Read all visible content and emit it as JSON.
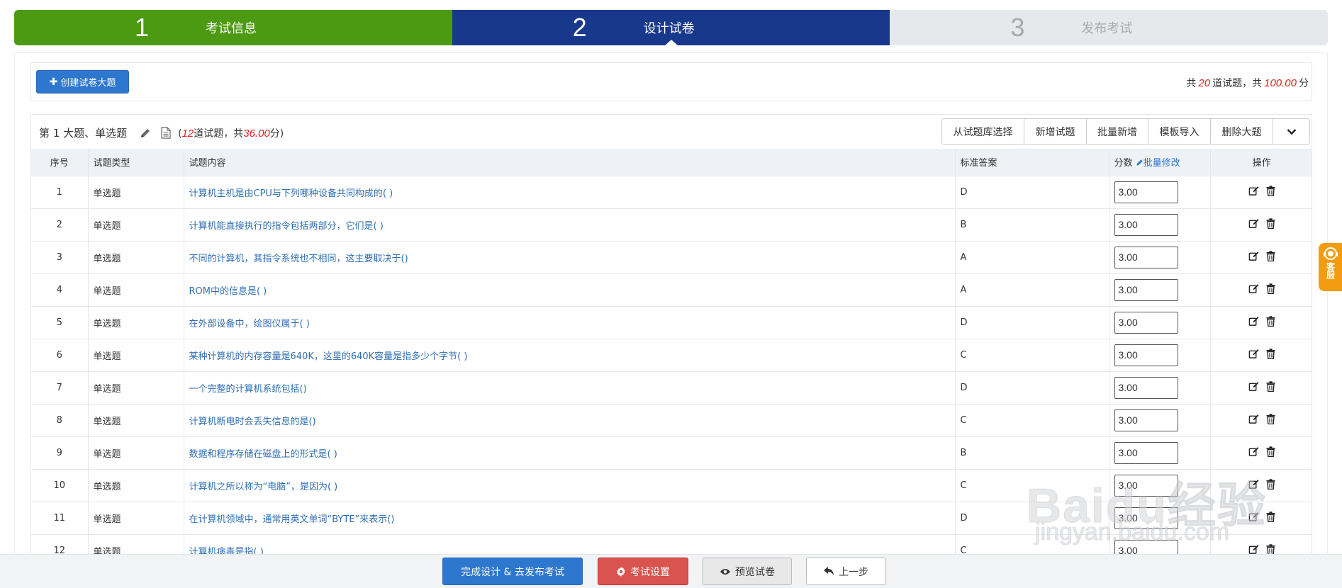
{
  "steps": [
    {
      "num": "1",
      "label": "考试信息"
    },
    {
      "num": "2",
      "label": "设计试卷"
    },
    {
      "num": "3",
      "label": "发布考试"
    }
  ],
  "toolbar": {
    "create_label": "创建试卷大题",
    "total_prefix": "共",
    "total_count": "20",
    "total_mid": "道试题，共",
    "total_score": "100.00",
    "total_suffix": "分"
  },
  "section": {
    "title": "第 1 大题、单选题",
    "count_open": "(",
    "count": "12",
    "count_mid": "道试题，共",
    "score": "36.00",
    "count_close": "分)",
    "buttons": [
      "从试题库选择",
      "新增试题",
      "批量新增",
      "模板导入",
      "删除大题"
    ]
  },
  "table": {
    "headers": {
      "no": "序号",
      "type": "试题类型",
      "content": "试题内容",
      "answer": "标准答案",
      "score": "分数",
      "batch": "批量修改",
      "op": "操作"
    },
    "rows": [
      {
        "no": "1",
        "type": "单选题",
        "content": "计算机主机是由CPU与下列哪种设备共同构成的( )",
        "answer": "D",
        "score": "3.00"
      },
      {
        "no": "2",
        "type": "单选题",
        "content": "计算机能直接执行的指令包括两部分，它们是( )",
        "answer": "B",
        "score": "3.00"
      },
      {
        "no": "3",
        "type": "单选题",
        "content": "不同的计算机，其指令系统也不相同，这主要取决于()",
        "answer": "A",
        "score": "3.00"
      },
      {
        "no": "4",
        "type": "单选题",
        "content": "ROM中的信息是( )",
        "answer": "A",
        "score": "3.00"
      },
      {
        "no": "5",
        "type": "单选题",
        "content": "在外部设备中，绘图仪属于( )",
        "answer": "D",
        "score": "3.00"
      },
      {
        "no": "6",
        "type": "单选题",
        "content": "某种计算机的内存容量是640K，这里的640K容量是指多少个字节( )",
        "answer": "C",
        "score": "3.00"
      },
      {
        "no": "7",
        "type": "单选题",
        "content": "一个完整的计算机系统包括()",
        "answer": "D",
        "score": "3.00"
      },
      {
        "no": "8",
        "type": "单选题",
        "content": "计算机断电时会丢失信息的是()",
        "answer": "C",
        "score": "3.00"
      },
      {
        "no": "9",
        "type": "单选题",
        "content": "数据和程序存储在磁盘上的形式是( )",
        "answer": "B",
        "score": "3.00"
      },
      {
        "no": "10",
        "type": "单选题",
        "content": "计算机之所以称为“电脑”，是因为( )",
        "answer": "C",
        "score": "3.00"
      },
      {
        "no": "11",
        "type": "单选题",
        "content": "在计算机领域中，通常用英文单词“BYTE”来表示()",
        "answer": "D",
        "score": "3.00"
      },
      {
        "no": "12",
        "type": "单选题",
        "content": "计算机病毒是指( )",
        "answer": "C",
        "score": "3.00"
      }
    ]
  },
  "footer": {
    "finish": "完成设计 & 去发布考试",
    "settings": "考试设置",
    "preview": "预览试卷",
    "back": "上一步"
  },
  "customer_service": "客服",
  "watermark": {
    "big": "Baidu经验",
    "small": "jingyan.baidu.com"
  },
  "colors": {
    "step_done": "#4c9a12",
    "step_active": "#18388c",
    "step_todo": "#e6e8ec",
    "primary": "#2e77cf",
    "danger": "#d9534f",
    "emphasis": "#e02020",
    "cs": "#f39c12"
  }
}
